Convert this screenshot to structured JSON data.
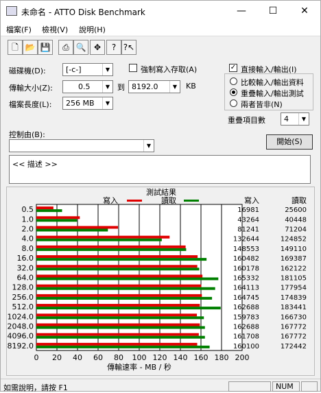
{
  "window": {
    "title": "未命名 - ATTO Disk Benchmark",
    "minimize": "—",
    "maximize": "☐",
    "close": "✕"
  },
  "menu": [
    "檔案(F)",
    "檢視(V)",
    "說明(H)"
  ],
  "toolbar": [
    "new-icon",
    "open-icon",
    "save-icon",
    "print-icon",
    "print-preview-icon",
    "move-icon",
    "help-icon",
    "context-help-icon"
  ],
  "form": {
    "drive_label": "磁碟機(D):",
    "drive_value": "[-c-]",
    "force_write_label": "強制寫入存取(A)",
    "transfer_label": "傳輸大小(Z):",
    "transfer_from": "0.5",
    "to_label": "到",
    "transfer_to": "8192.0",
    "kb_label": "KB",
    "filelen_label": "檔案長度(L):",
    "filelen_value": "256 MB",
    "direct_io_label": "直接輸入/輸出(I)",
    "radio1": "比較輸入/輸出資料",
    "radio2": "重疊輸入/輸出測試",
    "radio3": "兩者皆非(N)",
    "queue_label": "重疊項目數",
    "queue_value": "4",
    "control_label": "控制由(B):",
    "control_value": "",
    "start_button": "開始(S)",
    "description": "<< 描述 >>"
  },
  "chart_data": {
    "type": "bar",
    "title": "測試結果",
    "legend": [
      {
        "name": "寫入",
        "color": "#e00000"
      },
      {
        "name": "讀取",
        "color": "#008000"
      }
    ],
    "col_write": "寫入",
    "col_read": "讀取",
    "categories": [
      "0.5",
      "1.0",
      "2.0",
      "4.0",
      "8.0",
      "16.0",
      "32.0",
      "64.0",
      "128.0",
      "256.0",
      "512.0",
      "1024.0",
      "2048.0",
      "4096.0",
      "8192.0"
    ],
    "series": [
      {
        "name": "寫入",
        "values": [
          16981,
          43264,
          81241,
          132644,
          148553,
          160482,
          160178,
          165332,
          164113,
          164745,
          162688,
          159783,
          162688,
          161708,
          160100
        ]
      },
      {
        "name": "讀取",
        "values": [
          25600,
          40448,
          71204,
          124852,
          149110,
          169387,
          162122,
          181105,
          177954,
          174839,
          183441,
          166730,
          167772,
          167772,
          172442
        ]
      }
    ],
    "xlim": [
      0,
      200
    ],
    "xticks": [
      "0",
      "20",
      "40",
      "60",
      "80",
      "100",
      "120",
      "140",
      "160",
      "180",
      "200"
    ],
    "xlabel": "傳輸速率 - MB / 秒"
  },
  "status": {
    "text": "如需說明，請按 F1",
    "num": "NUM"
  }
}
